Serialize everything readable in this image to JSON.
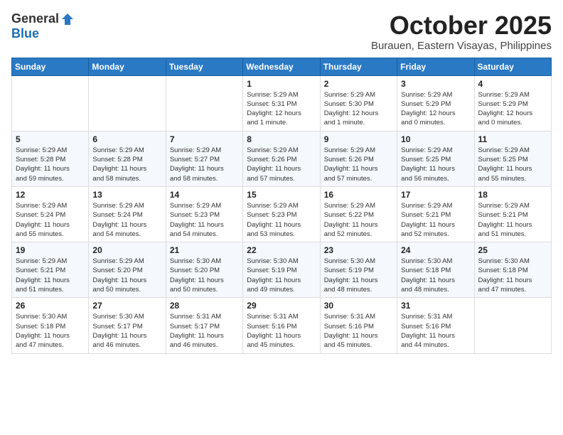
{
  "logo": {
    "general": "General",
    "blue": "Blue"
  },
  "title": "October 2025",
  "location": "Burauen, Eastern Visayas, Philippines",
  "headers": [
    "Sunday",
    "Monday",
    "Tuesday",
    "Wednesday",
    "Thursday",
    "Friday",
    "Saturday"
  ],
  "weeks": [
    [
      {
        "day": "",
        "info": ""
      },
      {
        "day": "",
        "info": ""
      },
      {
        "day": "",
        "info": ""
      },
      {
        "day": "1",
        "info": "Sunrise: 5:29 AM\nSunset: 5:31 PM\nDaylight: 12 hours\nand 1 minute."
      },
      {
        "day": "2",
        "info": "Sunrise: 5:29 AM\nSunset: 5:30 PM\nDaylight: 12 hours\nand 1 minute."
      },
      {
        "day": "3",
        "info": "Sunrise: 5:29 AM\nSunset: 5:29 PM\nDaylight: 12 hours\nand 0 minutes."
      },
      {
        "day": "4",
        "info": "Sunrise: 5:29 AM\nSunset: 5:29 PM\nDaylight: 12 hours\nand 0 minutes."
      }
    ],
    [
      {
        "day": "5",
        "info": "Sunrise: 5:29 AM\nSunset: 5:28 PM\nDaylight: 11 hours\nand 59 minutes."
      },
      {
        "day": "6",
        "info": "Sunrise: 5:29 AM\nSunset: 5:28 PM\nDaylight: 11 hours\nand 58 minutes."
      },
      {
        "day": "7",
        "info": "Sunrise: 5:29 AM\nSunset: 5:27 PM\nDaylight: 11 hours\nand 58 minutes."
      },
      {
        "day": "8",
        "info": "Sunrise: 5:29 AM\nSunset: 5:26 PM\nDaylight: 11 hours\nand 57 minutes."
      },
      {
        "day": "9",
        "info": "Sunrise: 5:29 AM\nSunset: 5:26 PM\nDaylight: 11 hours\nand 57 minutes."
      },
      {
        "day": "10",
        "info": "Sunrise: 5:29 AM\nSunset: 5:25 PM\nDaylight: 11 hours\nand 56 minutes."
      },
      {
        "day": "11",
        "info": "Sunrise: 5:29 AM\nSunset: 5:25 PM\nDaylight: 11 hours\nand 55 minutes."
      }
    ],
    [
      {
        "day": "12",
        "info": "Sunrise: 5:29 AM\nSunset: 5:24 PM\nDaylight: 11 hours\nand 55 minutes."
      },
      {
        "day": "13",
        "info": "Sunrise: 5:29 AM\nSunset: 5:24 PM\nDaylight: 11 hours\nand 54 minutes."
      },
      {
        "day": "14",
        "info": "Sunrise: 5:29 AM\nSunset: 5:23 PM\nDaylight: 11 hours\nand 54 minutes."
      },
      {
        "day": "15",
        "info": "Sunrise: 5:29 AM\nSunset: 5:23 PM\nDaylight: 11 hours\nand 53 minutes."
      },
      {
        "day": "16",
        "info": "Sunrise: 5:29 AM\nSunset: 5:22 PM\nDaylight: 11 hours\nand 52 minutes."
      },
      {
        "day": "17",
        "info": "Sunrise: 5:29 AM\nSunset: 5:21 PM\nDaylight: 11 hours\nand 52 minutes."
      },
      {
        "day": "18",
        "info": "Sunrise: 5:29 AM\nSunset: 5:21 PM\nDaylight: 11 hours\nand 51 minutes."
      }
    ],
    [
      {
        "day": "19",
        "info": "Sunrise: 5:29 AM\nSunset: 5:21 PM\nDaylight: 11 hours\nand 51 minutes."
      },
      {
        "day": "20",
        "info": "Sunrise: 5:29 AM\nSunset: 5:20 PM\nDaylight: 11 hours\nand 50 minutes."
      },
      {
        "day": "21",
        "info": "Sunrise: 5:30 AM\nSunset: 5:20 PM\nDaylight: 11 hours\nand 50 minutes."
      },
      {
        "day": "22",
        "info": "Sunrise: 5:30 AM\nSunset: 5:19 PM\nDaylight: 11 hours\nand 49 minutes."
      },
      {
        "day": "23",
        "info": "Sunrise: 5:30 AM\nSunset: 5:19 PM\nDaylight: 11 hours\nand 48 minutes."
      },
      {
        "day": "24",
        "info": "Sunrise: 5:30 AM\nSunset: 5:18 PM\nDaylight: 11 hours\nand 48 minutes."
      },
      {
        "day": "25",
        "info": "Sunrise: 5:30 AM\nSunset: 5:18 PM\nDaylight: 11 hours\nand 47 minutes."
      }
    ],
    [
      {
        "day": "26",
        "info": "Sunrise: 5:30 AM\nSunset: 5:18 PM\nDaylight: 11 hours\nand 47 minutes."
      },
      {
        "day": "27",
        "info": "Sunrise: 5:30 AM\nSunset: 5:17 PM\nDaylight: 11 hours\nand 46 minutes."
      },
      {
        "day": "28",
        "info": "Sunrise: 5:31 AM\nSunset: 5:17 PM\nDaylight: 11 hours\nand 46 minutes."
      },
      {
        "day": "29",
        "info": "Sunrise: 5:31 AM\nSunset: 5:16 PM\nDaylight: 11 hours\nand 45 minutes."
      },
      {
        "day": "30",
        "info": "Sunrise: 5:31 AM\nSunset: 5:16 PM\nDaylight: 11 hours\nand 45 minutes."
      },
      {
        "day": "31",
        "info": "Sunrise: 5:31 AM\nSunset: 5:16 PM\nDaylight: 11 hours\nand 44 minutes."
      },
      {
        "day": "",
        "info": ""
      }
    ]
  ]
}
